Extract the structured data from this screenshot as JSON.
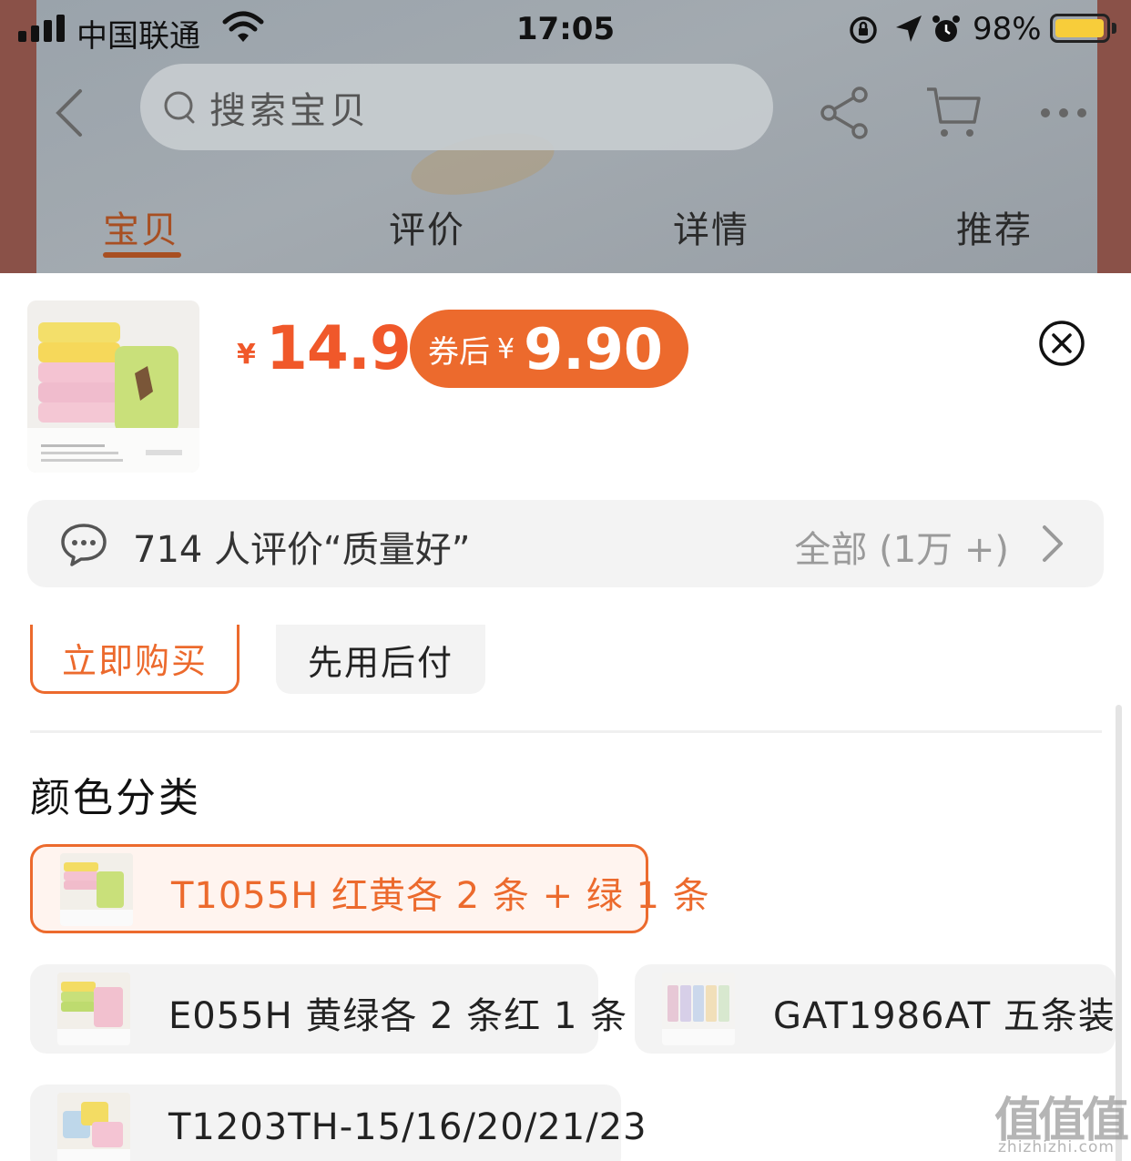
{
  "status_bar": {
    "carrier": "中国联通",
    "time": "17:05",
    "battery_percent": "98%",
    "battery_level": 0.98,
    "icons": [
      "signal-icon",
      "wifi-icon",
      "orientation-lock-icon",
      "location-icon",
      "alarm-icon",
      "battery-icon"
    ]
  },
  "nav": {
    "search_placeholder": "搜索宝贝",
    "icons": [
      "back-icon",
      "search-icon",
      "share-icon",
      "cart-icon",
      "more-icon"
    ]
  },
  "tabs": [
    {
      "label": "宝贝",
      "active": true
    },
    {
      "label": "评价",
      "active": false
    },
    {
      "label": "详情",
      "active": false
    },
    {
      "label": "推荐",
      "active": false
    }
  ],
  "product": {
    "currency_symbol": "¥",
    "price": "14.9",
    "coupon_label": "券后",
    "coupon_currency": "¥",
    "coupon_price": "9.90"
  },
  "review": {
    "summary": "714 人评价“质量好”",
    "all_label": "全部 (1万 +)"
  },
  "purchase_modes": {
    "buy_now": "立即购买",
    "pay_later": "先用后付"
  },
  "color_section": {
    "title": "颜色分类",
    "options": [
      {
        "label": "T1055H 红黄各 2 条 + 绿 1 条",
        "selected": true
      },
      {
        "label": "E055H 黄绿各 2 条红 1 条",
        "selected": false
      },
      {
        "label": "GAT1986AT 五条装",
        "selected": false
      },
      {
        "label": "T1203TH-15/16/20/21/23",
        "selected": false
      }
    ]
  },
  "watermark": {
    "main": "值值值",
    "sub": "zhizhizhi.com"
  },
  "colors": {
    "accent": "#ec6a2d",
    "price": "#f0582a",
    "tab_active": "#a84f22",
    "battery": "#f7cd3a"
  }
}
